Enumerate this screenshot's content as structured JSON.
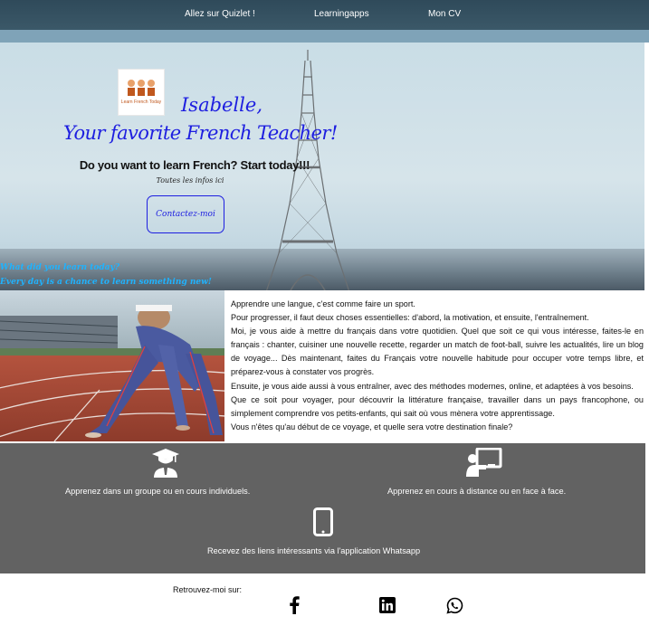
{
  "nav": {
    "links": [
      "Allez sur Quizlet !",
      "Learningapps",
      "Mon CV"
    ]
  },
  "hero": {
    "logo_text": "Learn French Today",
    "name": "Isabelle,",
    "title": "Your favorite French Teacher!",
    "question": "Do you want to learn French? Start today!!!",
    "infos": "Toutes les infos ici",
    "contact_label": "Contactez-moi",
    "learned": "What did you learn today?",
    "chance": "Every day is a chance to learn something new!"
  },
  "intro": {
    "paragraphs": [
      "Apprendre une langue, c'est comme faire un sport.",
      "Pour progresser, il faut deux choses essentielles: d'abord, la motivation, et ensuite, l'entraînement.",
      "Moi, je vous aide à mettre du français dans votre quotidien. Quel que soit ce qui vous intéresse, faites-le en français : chanter, cuisiner une nouvelle recette, regarder un match de foot-ball, suivre les actualités, lire un blog de voyage... Dès maintenant, faites du Français votre nouvelle habitude pour occuper votre temps libre, et préparez-vous à constater vos progrès.",
      "Ensuite, je vous aide aussi à vous entraîner, avec des méthodes modernes, online, et adaptées à vos besoins.",
      "Que ce soit pour voyager, pour découvrir la littérature française, travailler dans un pays francophone, ou simplement comprendre vos petits-enfants, qui sait où vous mènera votre apprentissage.",
      "Vous n'êtes qu'au début de ce voyage, et quelle sera votre destination finale?"
    ]
  },
  "features": {
    "group": "Apprenez dans un groupe ou en cours individuels.",
    "remote": "Apprenez en cours à distance ou en face à face.",
    "whatsapp": "Recevez des liens intéressants via l'application Whatsapp"
  },
  "footer": {
    "follow_label": "Retrouvez-moi sur:"
  },
  "colors": {
    "nav_bg": "#3b5868",
    "script_blue": "#1d1ee0",
    "cyan_text": "#1fb3ff",
    "features_bg": "#626262"
  },
  "icons": [
    "graduate-icon",
    "remote-teaching-icon",
    "smartphone-icon",
    "facebook-icon",
    "linkedin-icon",
    "whatsapp-icon"
  ]
}
